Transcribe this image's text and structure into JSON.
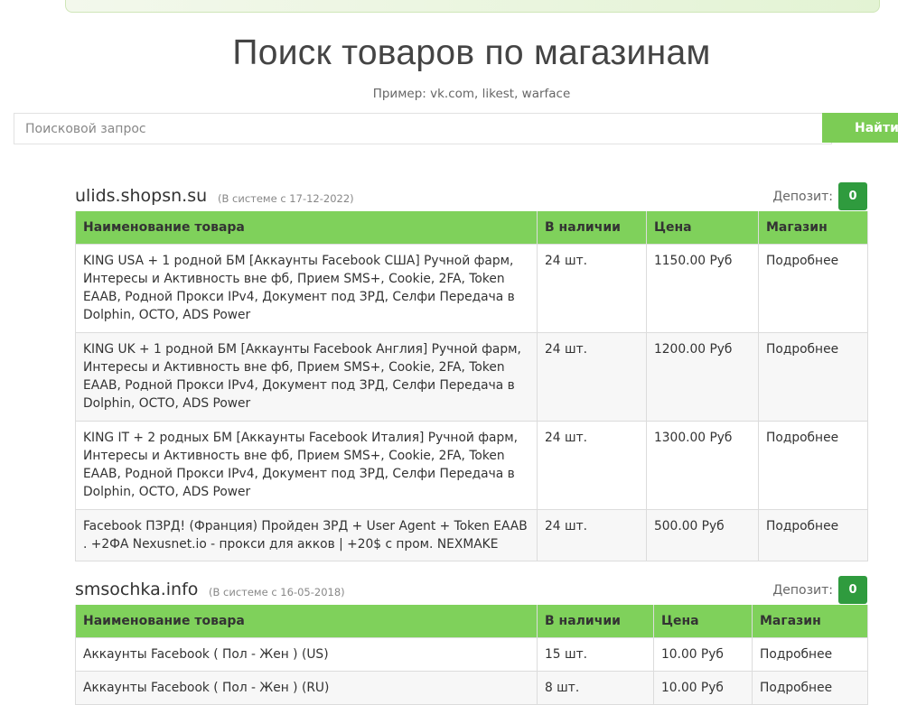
{
  "header": {
    "title": "Поиск товаров по магазинам",
    "hint": "Пример: vk.com, likest, warface"
  },
  "search": {
    "placeholder": "Поисковой запрос",
    "button_label": "Найти"
  },
  "columns": [
    "Наименование товара",
    "В наличии",
    "Цена",
    "Магазин"
  ],
  "shops": [
    {
      "name": "ulids.shopsn.su",
      "since": "(В системе с 17-12-2022)",
      "deposit_label": "Депозит:",
      "deposit_value": "0",
      "rows": [
        {
          "name": "KING USA + 1 родной БМ [Аккаунты Facebook США] Ручной фарм, Интересы и Активность вне фб, Прием SMS+, Cookie, 2FA, Token EAAB, Родной Прокси IPv4, Документ под ЗРД, Селфи Передача в Dolphin, OCTO, ADS Power",
          "stock": "24 шт.",
          "price": "1150.00 Руб",
          "shop": "Подробнее"
        },
        {
          "name": "KING UK + 1 родной БМ [Аккаунты Facebook Англия] Ручной фарм, Интересы и Активность вне фб, Прием SMS+, Cookie, 2FA, Token EAAB, Родной Прокси IPv4, Документ под ЗРД, Селфи Передача в Dolphin, OCTO, ADS Power",
          "stock": "24 шт.",
          "price": "1200.00 Руб",
          "shop": "Подробнее"
        },
        {
          "name": "KING IT + 2 родных БМ [Аккаунты Facebook Италия] Ручной фарм, Интересы и Активность вне фб, Прием SMS+, Cookie, 2FA, Token EAAB, Родной Прокси IPv4, Документ под ЗРД, Селфи Передача в Dolphin, OCTO, ADS Power",
          "stock": "24 шт.",
          "price": "1300.00 Руб",
          "shop": "Подробнее"
        },
        {
          "name": "Facebook ПЗРД! (Франция) Пройден ЗРД + User Agent + Token EAAB . +2ФА Nexusnet.io - прокси для акков | +20$ с пром. NEXMAKE",
          "stock": "24 шт.",
          "price": "500.00 Руб",
          "shop": "Подробнее"
        }
      ]
    },
    {
      "name": "smsochka.info",
      "since": "(В системе с 16-05-2018)",
      "deposit_label": "Депозит:",
      "deposit_value": "0",
      "rows": [
        {
          "name": "Аккаунты Facebook ( Пол - Жен ) (US)",
          "stock": "15 шт.",
          "price": "10.00 Руб",
          "shop": "Подробнее"
        },
        {
          "name": "Аккаунты Facebook ( Пол - Жен ) (RU)",
          "stock": "8 шт.",
          "price": "10.00 Руб",
          "shop": "Подробнее"
        }
      ]
    }
  ]
}
